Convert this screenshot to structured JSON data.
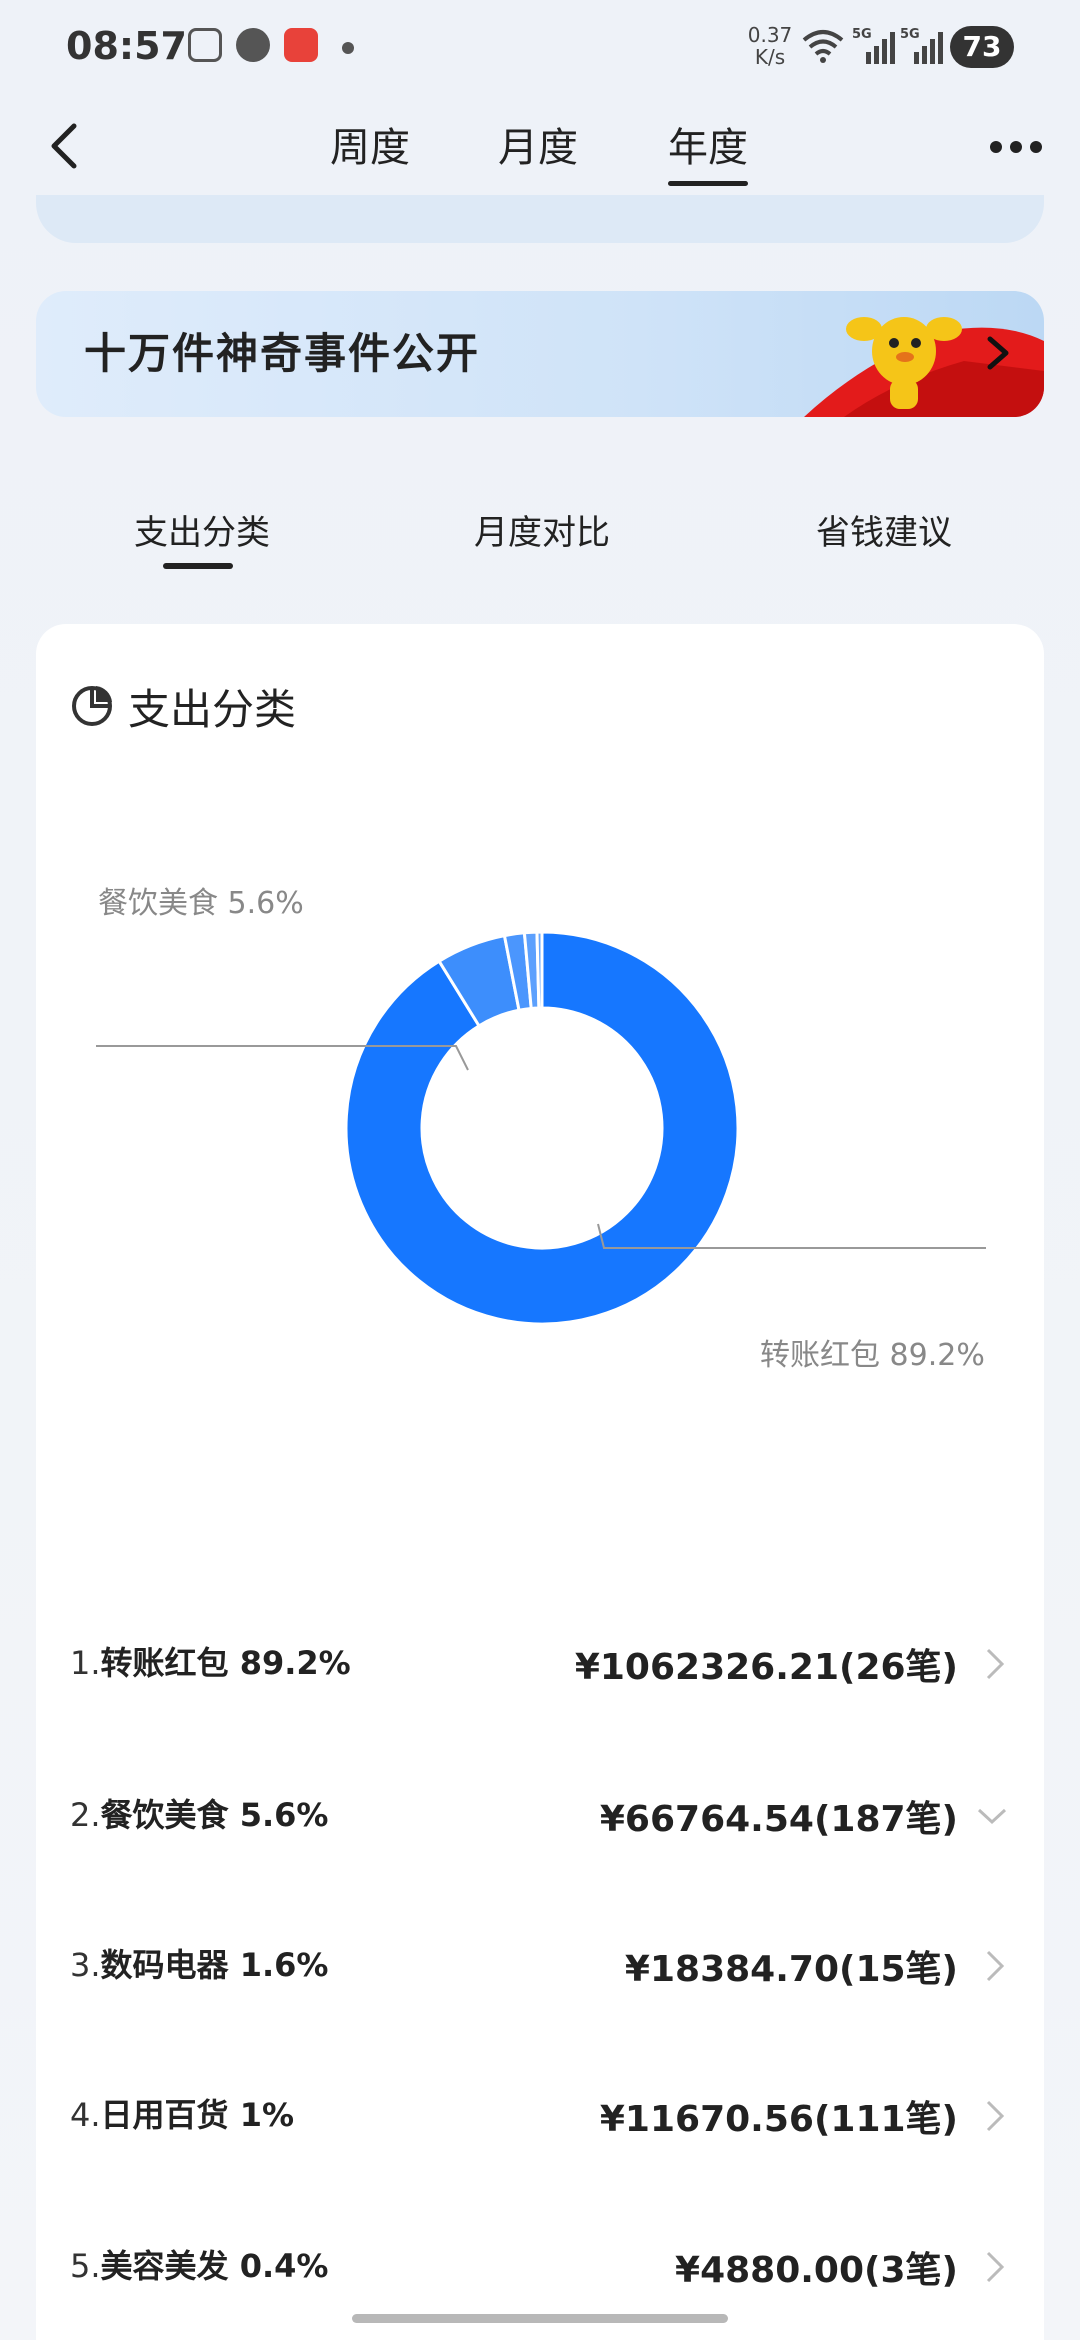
{
  "status_bar": {
    "time": "08:57",
    "net_speed_value": "0.37",
    "net_speed_unit": "K/s",
    "sig1": "5G",
    "sig2": "5G",
    "battery": "73"
  },
  "nav": {
    "tabs": [
      {
        "label": "周度",
        "active": false
      },
      {
        "label": "月度",
        "active": false
      },
      {
        "label": "年度",
        "active": true
      }
    ],
    "back_icon": "chevron-left-icon",
    "more_icon": "more-icon"
  },
  "banner": {
    "title": "十万件神奇事件公开"
  },
  "sub_tabs": [
    {
      "label": "支出分类",
      "active": true
    },
    {
      "label": "月度对比",
      "active": false
    },
    {
      "label": "省钱建议",
      "active": false
    }
  ],
  "card": {
    "title": "支出分类",
    "icon": "pie-chart-icon"
  },
  "chart_data": {
    "type": "pie",
    "donut": true,
    "categories": [
      "转账红包",
      "餐饮美食",
      "数码电器",
      "日用百货",
      "美容美发"
    ],
    "values": [
      89.2,
      5.6,
      1.6,
      1.0,
      0.4
    ],
    "unit": "%",
    "colors": [
      "#1677ff",
      "#3d8efc",
      "#4b96fd",
      "#5ca0fd",
      "#6aa8fd"
    ],
    "callouts": [
      {
        "label": "餐饮美食 5.6%"
      },
      {
        "label": "转账红包 89.2%"
      }
    ]
  },
  "list": [
    {
      "rank": "1.",
      "name": "转账红包",
      "pct": "89.2%",
      "amount": "¥1062326.21(26笔)",
      "chevron": "chevron-right-icon"
    },
    {
      "rank": "2.",
      "name": "餐饮美食",
      "pct": "5.6%",
      "amount": "¥66764.54(187笔)",
      "chevron": "chevron-down-icon"
    },
    {
      "rank": "3.",
      "name": "数码电器",
      "pct": "1.6%",
      "amount": "¥18384.70(15笔)",
      "chevron": "chevron-right-icon"
    },
    {
      "rank": "4.",
      "name": "日用百货",
      "pct": "1%",
      "amount": "¥11670.56(111笔)",
      "chevron": "chevron-right-icon"
    },
    {
      "rank": "5.",
      "name": "美容美发",
      "pct": "0.4%",
      "amount": "¥4880.00(3笔)",
      "chevron": "chevron-right-icon"
    }
  ]
}
